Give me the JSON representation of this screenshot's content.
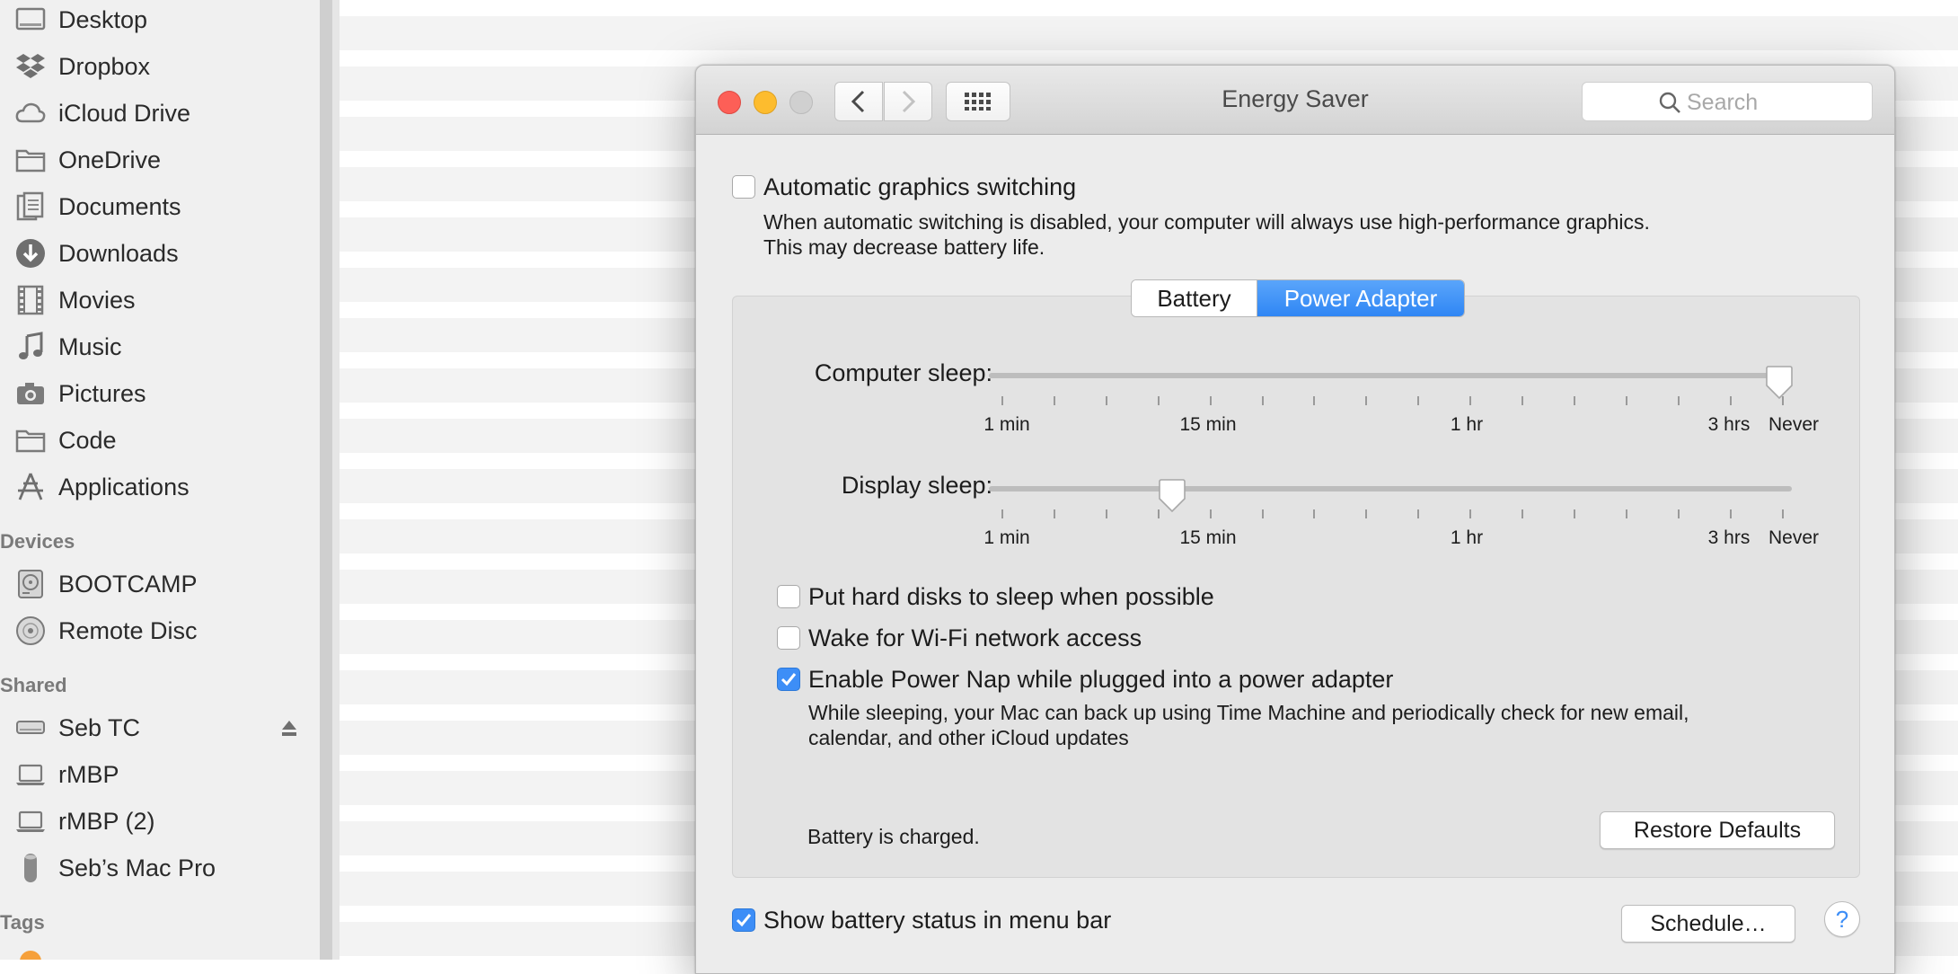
{
  "sidebar": {
    "favorites": [
      {
        "label": "Desktop",
        "icon": "desktop-icon"
      },
      {
        "label": "Dropbox",
        "icon": "dropbox-icon"
      },
      {
        "label": "iCloud Drive",
        "icon": "cloud-icon"
      },
      {
        "label": "OneDrive",
        "icon": "folder-icon"
      },
      {
        "label": "Documents",
        "icon": "documents-icon"
      },
      {
        "label": "Downloads",
        "icon": "download-icon"
      },
      {
        "label": "Movies",
        "icon": "film-icon"
      },
      {
        "label": "Music",
        "icon": "music-note-icon"
      },
      {
        "label": "Pictures",
        "icon": "camera-icon"
      },
      {
        "label": "Code",
        "icon": "folder-icon"
      },
      {
        "label": "Applications",
        "icon": "applications-icon"
      }
    ],
    "devices_heading": "Devices",
    "devices": [
      {
        "label": "BOOTCAMP",
        "icon": "hard-disk-icon"
      },
      {
        "label": "Remote Disc",
        "icon": "disc-icon"
      }
    ],
    "shared_heading": "Shared",
    "shared": [
      {
        "label": "Seb TC",
        "icon": "time-capsule-icon"
      },
      {
        "label": "rMBP",
        "icon": "laptop-icon"
      },
      {
        "label": "rMBP (2)",
        "icon": "laptop-icon"
      },
      {
        "label": "Seb’s Mac Pro",
        "icon": "mac-pro-icon"
      }
    ],
    "tags_heading": "Tags"
  },
  "window": {
    "title": "Energy Saver",
    "search_placeholder": "Search",
    "auto_graphics": {
      "label": "Automatic graphics switching",
      "checked": false,
      "description_line1": "When automatic switching is disabled, your computer will always use high-performance graphics.",
      "description_line2": "This may decrease battery life."
    },
    "tabs": {
      "battery": "Battery",
      "power_adapter": "Power Adapter",
      "selected": "power_adapter"
    },
    "computer_sleep": {
      "label": "Computer sleep:",
      "value": "Never"
    },
    "display_sleep": {
      "label": "Display sleep:",
      "value": "15 min"
    },
    "slider_scale": {
      "l1": "1 min",
      "l2": "15 min",
      "l3": "1 hr",
      "l4": "3 hrs",
      "l5": "Never"
    },
    "options": {
      "hard_disks": {
        "label": "Put hard disks to sleep when possible",
        "checked": false
      },
      "wake_wifi": {
        "label": "Wake for Wi-Fi network access",
        "checked": false
      },
      "power_nap": {
        "label": "Enable Power Nap while plugged into a power adapter",
        "checked": true,
        "description_line1": "While sleeping, your Mac can back up using Time Machine and periodically check for new email,",
        "description_line2": "calendar, and other iCloud updates"
      }
    },
    "battery_status": "Battery is charged.",
    "restore_defaults": "Restore Defaults",
    "show_battery_status": {
      "label": "Show battery status in menu bar",
      "checked": true
    },
    "schedule": "Schedule…",
    "help": "?"
  }
}
